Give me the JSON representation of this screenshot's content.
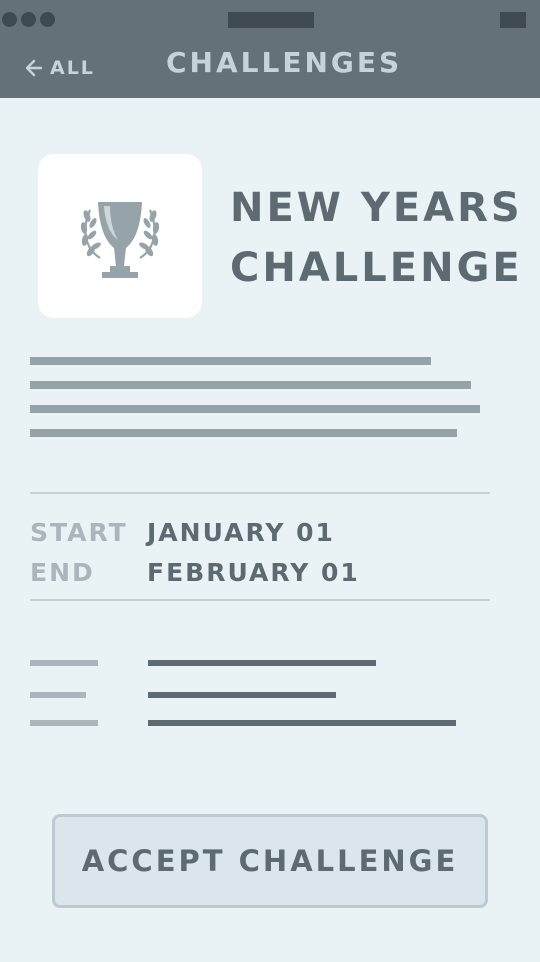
{
  "header": {
    "title": "CHALLENGES",
    "back_label": "ALL",
    "back_icon": "arrow-left-icon"
  },
  "status_bar": {
    "signal_icon": "signal-dots-icon",
    "battery_icon": "battery-icon"
  },
  "challenge": {
    "icon": "trophy-icon",
    "title_line1": "NEW YEARS",
    "title_line2": "CHALLENGE",
    "start_label": "START",
    "start_value": "JANUARY 01",
    "end_label": "END",
    "end_value": "FEBRUARY 01"
  },
  "actions": {
    "accept_label": "ACCEPT CHALLENGE"
  },
  "colors": {
    "header_bg": "#647178",
    "page_bg": "#e9f3f6",
    "text_dark": "#5d6a71",
    "text_muted": "#aab6bb",
    "button_bg": "#dae6eb"
  }
}
